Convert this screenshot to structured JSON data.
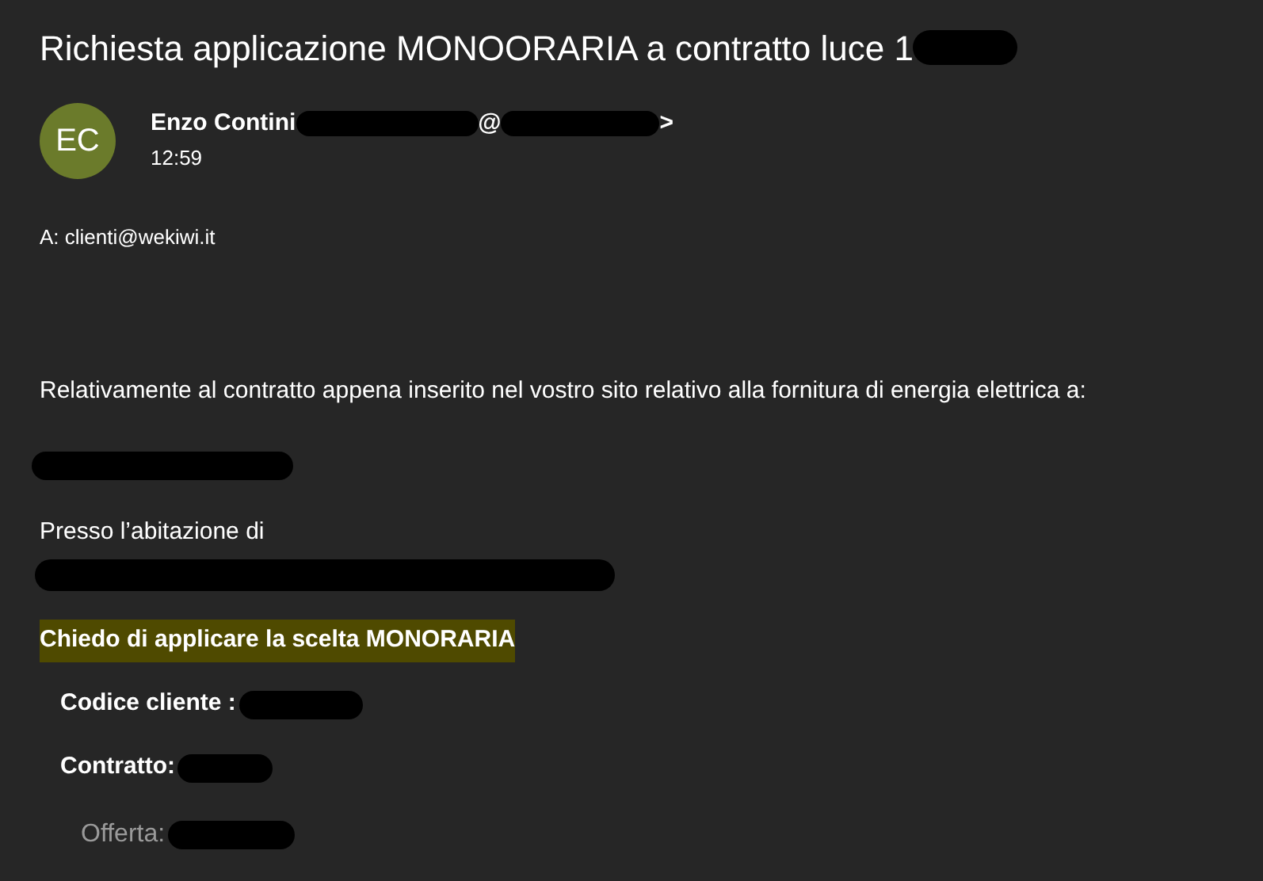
{
  "title": [
    {
      "kind": "text",
      "text": "Richiesta applicazione MONOORARIA a contratto luce 1"
    },
    {
      "kind": "redaction"
    }
  ],
  "sender": {
    "initials": "EC",
    "color": "#6b7b2b",
    "from": [
      {
        "kind": "text",
        "text": "Enzo Contini"
      },
      {
        "kind": "redaction"
      },
      {
        "kind": "text",
        "text": "@"
      },
      {
        "kind": "redaction"
      },
      {
        "kind": "text",
        "text": ">"
      }
    ],
    "time": "12:59"
  },
  "to": "A: clienti@wekiwi.it",
  "body": [
    {
      "kind": "plain",
      "parts": [
        {
          "kind": "text",
          "text": "Relativamente al contratto appena inserito nel vostro sito relativo alla fornitura di energia elettrica a:"
        }
      ]
    },
    {
      "kind": "plain",
      "parts": [
        {
          "kind": "redaction"
        }
      ]
    },
    {
      "kind": "plain",
      "parts": [
        {
          "kind": "text",
          "text": "Presso l’abitazione di"
        }
      ]
    },
    {
      "kind": "tight",
      "parts": [
        {
          "kind": "redaction"
        }
      ]
    },
    {
      "kind": "highlight",
      "parts": [
        {
          "kind": "highlighted",
          "text": "Chiedo di applicare la scelta MONORARIA"
        }
      ]
    },
    {
      "kind": "bold",
      "parts": [
        {
          "kind": "text",
          "text": "Codice cliente :"
        },
        {
          "kind": "redaction"
        }
      ]
    },
    {
      "kind": "bold",
      "parts": [
        {
          "kind": "text",
          "text": "Contratto:"
        },
        {
          "kind": "redaction"
        }
      ]
    },
    {
      "kind": "gray",
      "parts": [
        {
          "kind": "text",
          "text": "Offerta:"
        },
        {
          "kind": "redaction"
        }
      ]
    }
  ]
}
